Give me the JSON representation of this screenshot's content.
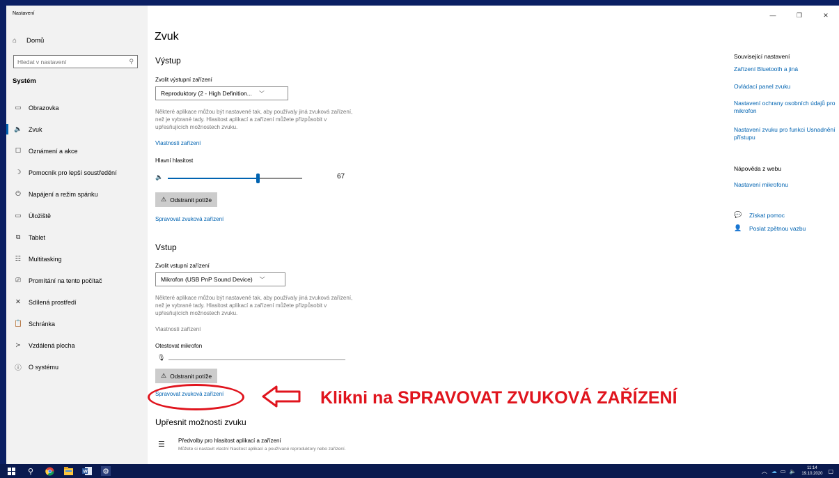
{
  "window": {
    "title": "Nastavení",
    "minimize_glyph": "—",
    "maximize_glyph": "❐",
    "close_glyph": "✕"
  },
  "sidebar": {
    "home_label": "Domů",
    "home_icon": "home-icon",
    "search_placeholder": "Hledat v nastavení",
    "section_label": "Systém",
    "items": [
      {
        "label": "Obrazovka",
        "icon": "monitor-icon",
        "glyph": "▭",
        "active": false
      },
      {
        "label": "Zvuk",
        "icon": "speaker-icon",
        "glyph": "🔈",
        "active": true
      },
      {
        "label": "Oznámení a akce",
        "icon": "notification-icon",
        "glyph": "☐",
        "active": false
      },
      {
        "label": "Pomocník pro lepší soustředění",
        "icon": "moon-icon",
        "glyph": "☽",
        "active": false
      },
      {
        "label": "Napájení a režim spánku",
        "icon": "power-icon",
        "glyph": "⏻",
        "active": false
      },
      {
        "label": "Úložiště",
        "icon": "storage-icon",
        "glyph": "▭",
        "active": false
      },
      {
        "label": "Tablet",
        "icon": "tablet-icon",
        "glyph": "⧉",
        "active": false
      },
      {
        "label": "Multitasking",
        "icon": "multitasking-icon",
        "glyph": "☷",
        "active": false
      },
      {
        "label": "Promítání na tento počítač",
        "icon": "projection-icon",
        "glyph": "⎚",
        "active": false
      },
      {
        "label": "Sdílená prostředí",
        "icon": "shared-icon",
        "glyph": "✕",
        "active": false
      },
      {
        "label": "Schránka",
        "icon": "clipboard-icon",
        "glyph": "📋",
        "active": false
      },
      {
        "label": "Vzdálená plocha",
        "icon": "remote-icon",
        "glyph": "≻",
        "active": false
      },
      {
        "label": "O systému",
        "icon": "info-icon",
        "glyph": "ⓘ",
        "active": false
      }
    ]
  },
  "main": {
    "title": "Zvuk",
    "output": {
      "heading": "Výstup",
      "device_label": "Zvolit výstupní zařízení",
      "device_value": "Reproduktory (2 - High Definition...",
      "description": "Některé aplikace můžou být nastavené tak, aby používaly jiná zvuková zařízení, než je vybrané tady. Hlasitost aplikací a zařízení můžete přizpůsobit v upřesňujících možnostech zvuku.",
      "properties_link": "Vlastnosti zařízení",
      "volume_label": "Hlavní hlasitost",
      "volume_value": "67",
      "volume_level": 67,
      "troubleshoot_label": "Odstranit potíže",
      "manage_link": "Spravovat zvuková zařízení"
    },
    "input": {
      "heading": "Vstup",
      "device_label": "Zvolit vstupní zařízení",
      "device_value": "Mikrofon (USB PnP Sound Device)",
      "description": "Některé aplikace můžou být nastavené tak, aby používaly jiná zvuková zařízení, než je vybrané tady. Hlasitost aplikací a zařízení můžete přizpůsobit v upřesňujících možnostech zvuku.",
      "properties_link": "Vlastnosti zařízení",
      "test_label": "Otestovat mikrofon",
      "troubleshoot_label": "Odstranit potíže",
      "manage_link": "Spravovat zvuková zařízení"
    },
    "advanced": {
      "heading": "Upřesnit možnosti zvuku",
      "option_title": "Předvolby pro hlasitost aplikací a zařízení",
      "option_desc": "Můžete si nastavit vlastní hlasitost aplikací a používané reproduktory nebo zařízení."
    },
    "annotation": {
      "text": "Klikni na SPRAVOVAT ZVUKOVÁ ZAŘÍZENÍ",
      "color": "#e0141d"
    }
  },
  "related": {
    "heading": "Související nastavení",
    "links": [
      "Zařízení Bluetooth a jiná",
      "Ovládací panel zvuku",
      "Nastavení ochrany osobních údajů pro mikrofon",
      "Nastavení zvuku pro funkci Usnadnění přístupu"
    ],
    "help_heading": "Nápověda z webu",
    "help_link": "Nastavení mikrofonu",
    "get_help": "Získat pomoc",
    "feedback": "Poslat zpětnou vazbu"
  },
  "taskbar": {
    "time": "11:14",
    "date": "19.10.2020"
  },
  "colors": {
    "accent": "#0063b1",
    "background_desktop": "#0b1f63",
    "annotation_red": "#e0141d"
  }
}
